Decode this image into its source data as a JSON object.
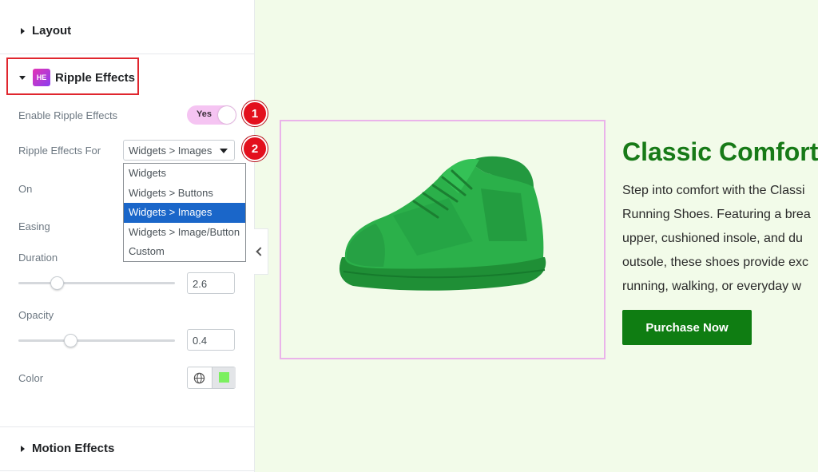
{
  "panel": {
    "layout_section": "Layout",
    "ripple_section": "Ripple Effects",
    "ripple_icon_text": "HE",
    "enable_label": "Enable Ripple Effects",
    "enable_value": "Yes",
    "for_label": "Ripple Effects For",
    "for_value": "Widgets > Images",
    "options": [
      "Widgets",
      "Widgets > Buttons",
      "Widgets > Images",
      "Widgets > Image/Button",
      "Custom"
    ],
    "on_label": "On",
    "easing_label": "Easing",
    "duration_label": "Duration",
    "duration_value": "2.6",
    "opacity_label": "Opacity",
    "opacity_value": "0.4",
    "color_label": "Color",
    "color_value": "#7bf05f",
    "motion_section": "Motion Effects"
  },
  "badges": [
    "1",
    "2"
  ],
  "preview": {
    "title": "Classic Comfort",
    "desc_lines": [
      "Step into comfort with the Classi",
      "Running Shoes. Featuring a brea",
      "upper, cushioned insole, and du",
      "outsole, these shoes provide exc",
      "running, walking, or everyday w"
    ],
    "cta": "Purchase Now",
    "shoe_color": "#27a845"
  },
  "colors": {
    "accent_pink": "#f5c4f2",
    "brand_green": "#0f7d12",
    "badge_red": "#e3101d",
    "select_blue": "#1a66c9"
  }
}
